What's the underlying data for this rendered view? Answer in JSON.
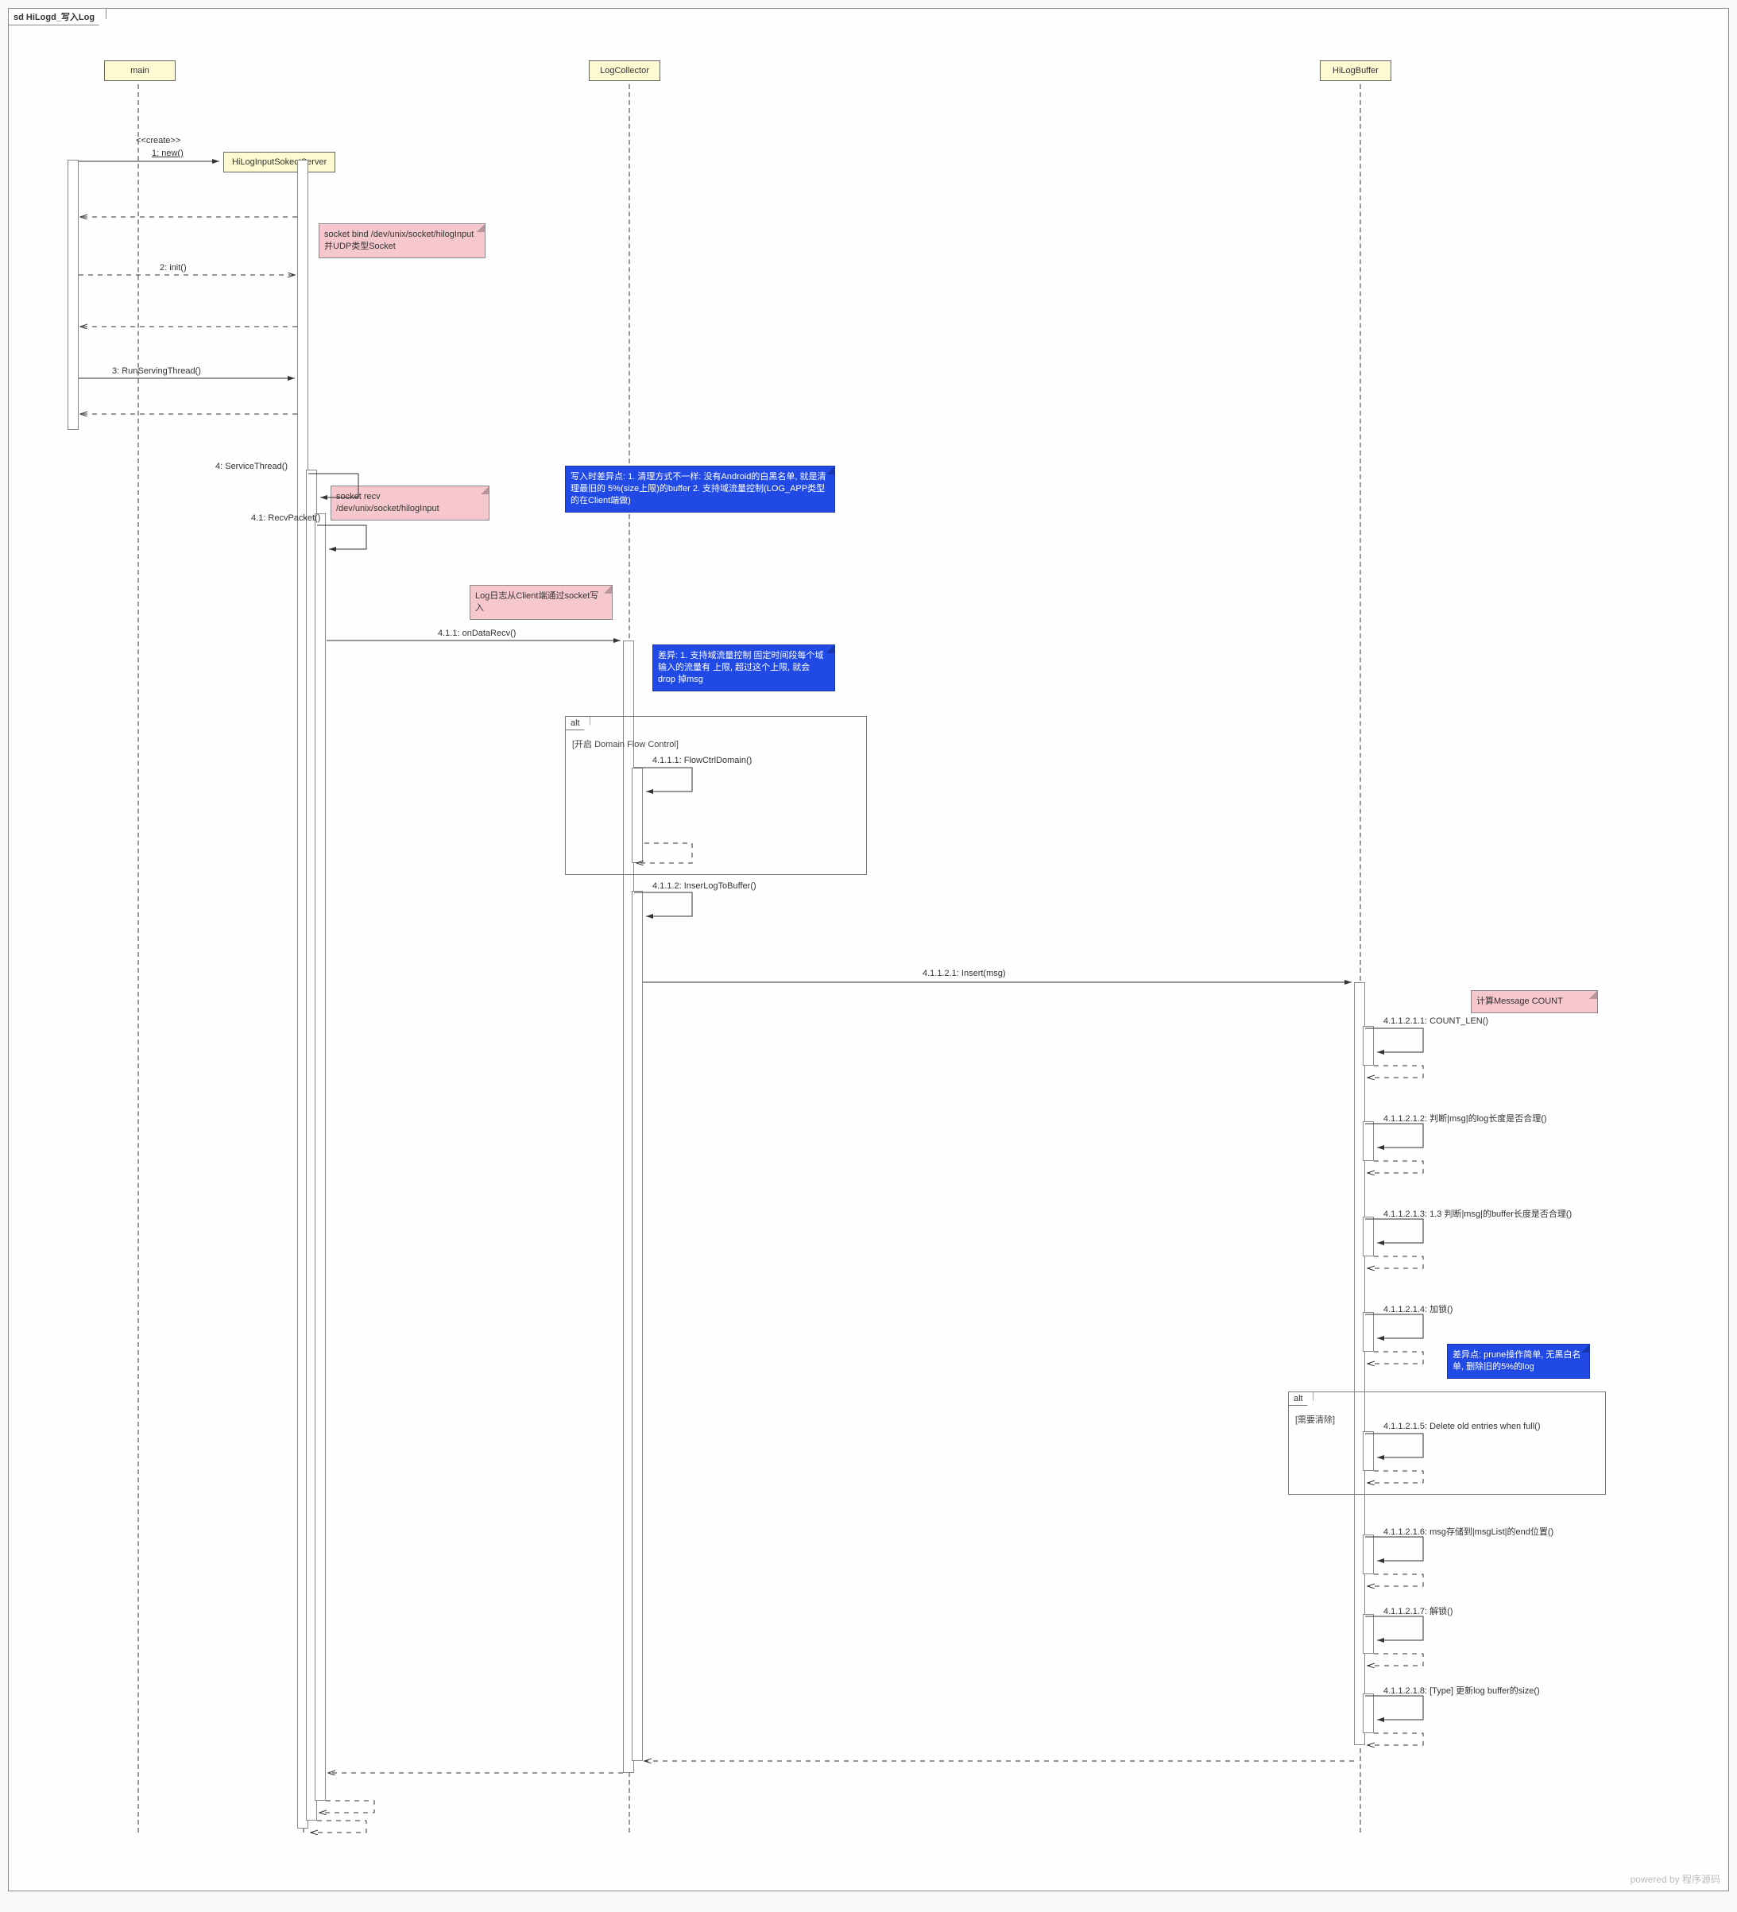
{
  "diagram": {
    "frame_prefix": "sd",
    "frame_title": "HiLogd_写入Log",
    "watermark": "powered by 程序源码"
  },
  "lifelines": {
    "main": "main",
    "server": "HiLogInputSokectServer",
    "collector": "LogCollector",
    "buffer": "HiLogBuffer"
  },
  "messages": {
    "create_stereotype": "<<create>>",
    "m1": "1: new()",
    "m2": "2: init()",
    "m3": "3: RunServingThread()",
    "m4": "4: ServiceThread()",
    "m4_1": "4.1: RecvPacket()",
    "m4_1_1": "4.1.1: onDataRecv()",
    "m4_1_1_1": "4.1.1.1: FlowCtrlDomain()",
    "m4_1_1_2": "4.1.1.2: InserLogToBuffer()",
    "m4_1_1_2_1": "4.1.1.2.1: Insert(msg)",
    "m4_1_1_2_1_1": "4.1.1.2.1.1: COUNT_LEN()",
    "m4_1_1_2_1_2": "4.1.1.2.1.2: 判断|msg|的log长度是否合理()",
    "m4_1_1_2_1_3": "4.1.1.2.1.3: 1.3 判断|msg|的buffer长度是否合理()",
    "m4_1_1_2_1_4": "4.1.1.2.1.4: 加锁()",
    "m4_1_1_2_1_5": "4.1.1.2.1.5: Delete old entries when full()",
    "m4_1_1_2_1_6": "4.1.1.2.1.6: msg存储到|msgList|的end位置()",
    "m4_1_1_2_1_7": "4.1.1.2.1.7: 解锁()",
    "m4_1_1_2_1_8": "4.1.1.2.1.8: [Type] 更新log buffer的size()"
  },
  "notes": {
    "n_socket_bind": "socket bind /dev/unix/socket/hilogInput 并UDP类型Socket",
    "n_socket_recv": "socket recv /dev/unix/socket/hilogInput",
    "n_client_write": "Log日志从Client端通过socket写入",
    "n_diff": "写入时差异点: 1. 清理方式不一样: 没有Android的白黑名单, 就是清理最旧的 5%(size上限)的buffer 2. 支持域流量控制(LOG_APP类型的在Client端做)",
    "n_domain": "差异: 1. 支持域流量控制 固定时间段每个域输入的流量有 上限, 超过这个上限, 就会drop 掉msg",
    "n_count": "计算Message COUNT",
    "n_prune": "差异点: prune操作简单, 无黑白名 单, 删除旧的5%的log"
  },
  "fragments": {
    "alt1_label": "alt",
    "alt1_guard": "[开启 Domain Flow Control]",
    "alt2_label": "alt",
    "alt2_guard": "[需要清除]"
  }
}
